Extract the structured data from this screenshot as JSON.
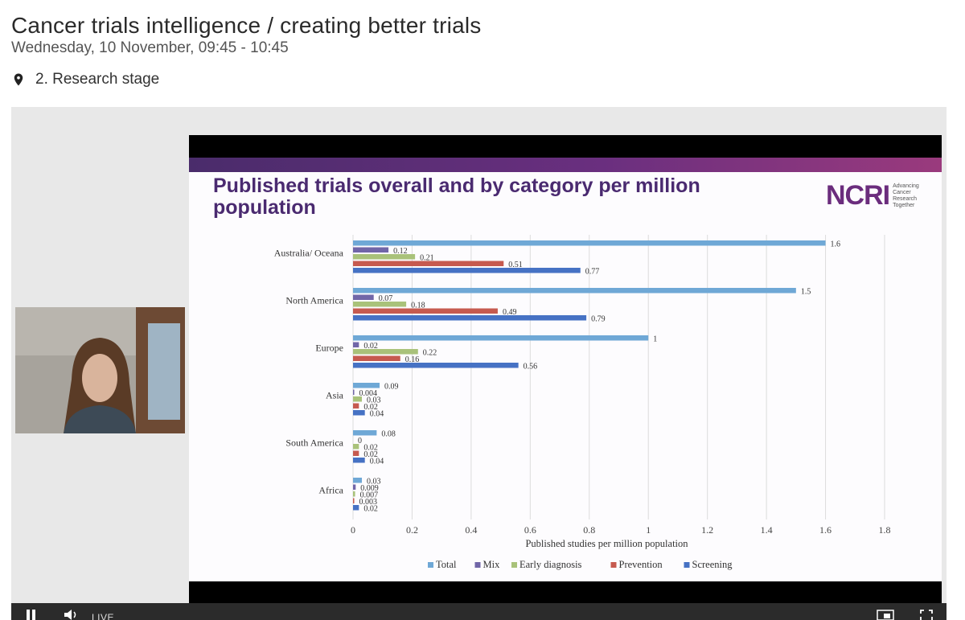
{
  "session": {
    "title": "Cancer trials intelligence / creating better trials",
    "time": "Wednesday, 10 November, 09:45 - 10:45",
    "location": "2. Research stage"
  },
  "icons": {
    "location": "map-pin-icon",
    "pause": "pause-icon",
    "volume": "volume-icon",
    "pip": "picture-in-picture-icon",
    "fullscreen": "fullscreen-icon"
  },
  "player": {
    "live_label": "LIVE"
  },
  "slide": {
    "title": "Published trials overall and by category per million population",
    "logo_mark": "NCRI",
    "logo_tagline": "Advancing Cancer Research Together"
  },
  "chart_data": {
    "type": "bar",
    "orientation": "horizontal",
    "categories": [
      "Australia/ Oceana",
      "North America",
      "Europe",
      "Asia",
      "South America",
      "Africa"
    ],
    "series": [
      {
        "name": "Total",
        "color": "#6fa8d6",
        "values": [
          1.6,
          1.5,
          1,
          0.09,
          0.08,
          0.03
        ],
        "labels": [
          "1.6",
          "1.5",
          "1",
          "0.09",
          "0.08",
          "0.03"
        ]
      },
      {
        "name": "Mix",
        "color": "#7166a8",
        "values": [
          0.12,
          0.07,
          0.02,
          0.004,
          0,
          0.009
        ],
        "labels": [
          "0.12",
          "0.07",
          "0.02",
          "0.004",
          "0",
          "0.009"
        ]
      },
      {
        "name": "Early diagnosis",
        "color": "#a9c27a",
        "values": [
          0.21,
          0.18,
          0.22,
          0.03,
          0.02,
          0.007
        ],
        "labels": [
          "0.21",
          "0.18",
          "0.22",
          "0.03",
          "0.02",
          "0.007"
        ]
      },
      {
        "name": "Prevention",
        "color": "#c65a4f",
        "values": [
          0.51,
          0.49,
          0.16,
          0.02,
          0.02,
          0.003
        ],
        "labels": [
          "0.51",
          "0.49",
          "0.16",
          "0.02",
          "0.02",
          "0.003"
        ]
      },
      {
        "name": "Screening",
        "color": "#4672c4",
        "values": [
          0.77,
          0.79,
          0.56,
          0.04,
          0.04,
          0.02
        ],
        "labels": [
          "0.77",
          "0.79",
          "0.56",
          "0.04",
          "0.04",
          "0.02"
        ]
      }
    ],
    "xlabel": "Published studies per million population",
    "xlim": [
      0,
      1.8
    ],
    "xticks": [
      "0",
      "0.2",
      "0.4",
      "0.6",
      "0.8",
      "1",
      "1.2",
      "1.4",
      "1.6",
      "1.8"
    ],
    "grid": true,
    "legend": "bottom"
  }
}
